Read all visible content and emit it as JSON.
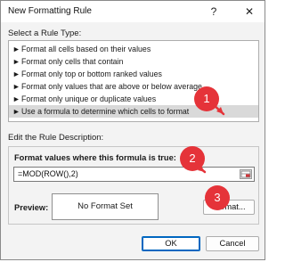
{
  "dialog": {
    "title": "New Formatting Rule",
    "help_glyph": "?",
    "close_glyph": "✕"
  },
  "rule_type": {
    "label": "Select a Rule Type:",
    "arrow_glyph": "►",
    "items": [
      "Format all cells based on their values",
      "Format only cells that contain",
      "Format only top or bottom ranked values",
      "Format only values that are above or below average",
      "Format only unique or duplicate values",
      "Use a formula to determine which cells to format"
    ],
    "selected_index": 5
  },
  "description": {
    "label": "Edit the Rule Description:",
    "formula_label": "Format values where this formula is true:",
    "formula_value": "=MOD(ROW(),2)",
    "preview_label": "Preview:",
    "preview_text": "No Format Set",
    "format_button": "Format..."
  },
  "buttons": {
    "ok": "OK",
    "cancel": "Cancel"
  },
  "callouts": {
    "color": "#e53339",
    "labels": [
      "1",
      "2",
      "3"
    ]
  },
  "icons": {
    "range_picker": "range-select-icon"
  }
}
